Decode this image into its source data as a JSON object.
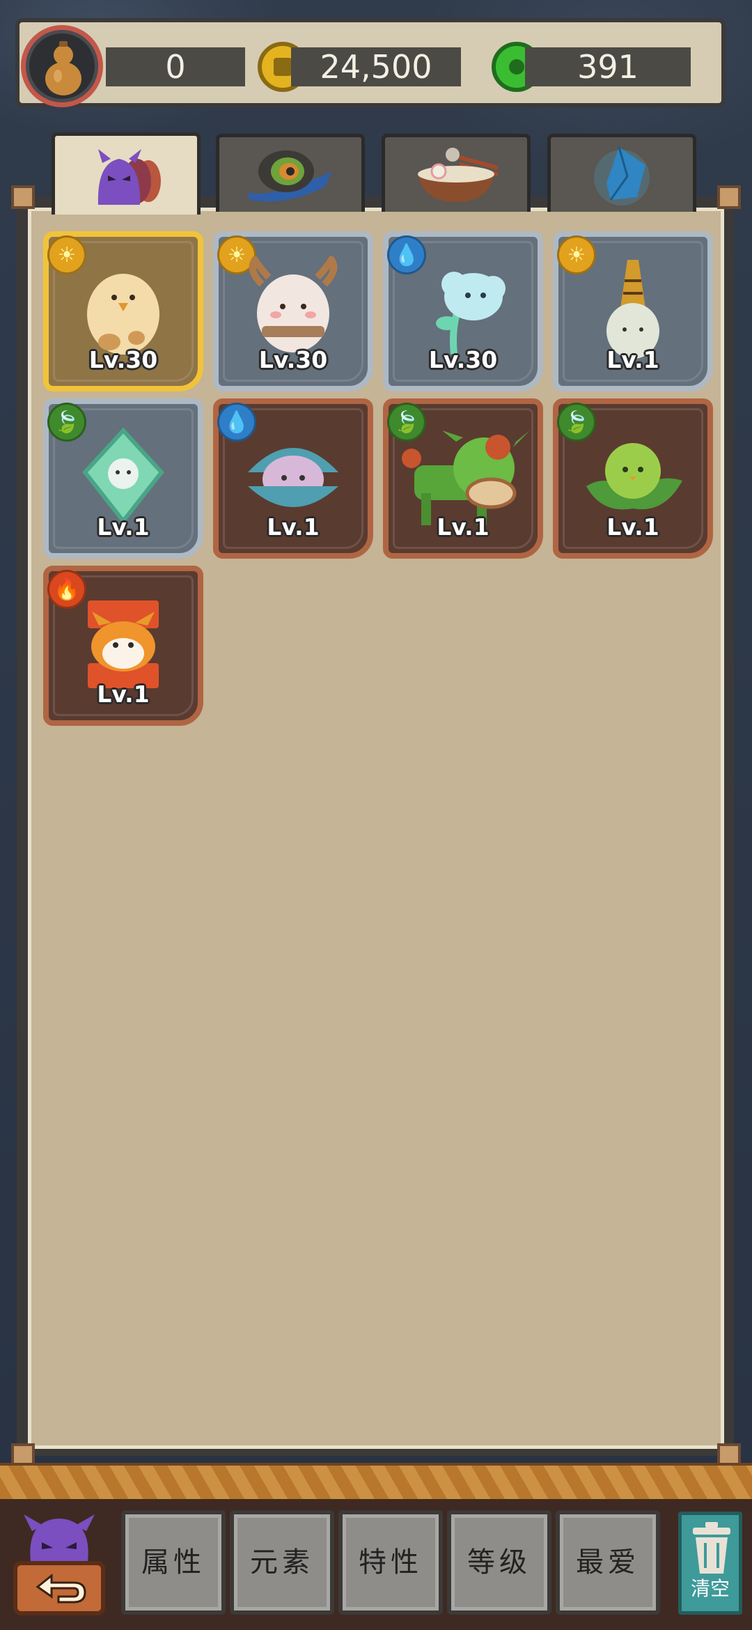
{
  "resources": {
    "gourd_count": "0",
    "coins": "24,500",
    "jade": "391"
  },
  "tabs": [
    {
      "icon": "monster-group-icon",
      "active": true
    },
    {
      "icon": "peacock-feather-icon",
      "active": false
    },
    {
      "icon": "noodle-bowl-icon",
      "active": false
    },
    {
      "icon": "blue-crystal-icon",
      "active": false
    }
  ],
  "pets": [
    {
      "level": "Lv.30",
      "rarity": "gold",
      "element": "sun",
      "creature": "chick-egg"
    },
    {
      "level": "Lv.30",
      "rarity": "silver",
      "element": "sun",
      "creature": "deer-egg"
    },
    {
      "level": "Lv.30",
      "rarity": "silver",
      "element": "water",
      "creature": "cloud-sprout"
    },
    {
      "level": "Lv.1",
      "rarity": "silver",
      "element": "sun",
      "creature": "bell-ghost"
    },
    {
      "level": "Lv.1",
      "rarity": "silver",
      "element": "leaf",
      "creature": "diamond-spirit"
    },
    {
      "level": "Lv.1",
      "rarity": "copper",
      "element": "water",
      "creature": "clam-spirit"
    },
    {
      "level": "Lv.1",
      "rarity": "copper",
      "element": "leaf",
      "creature": "bamboo-cow"
    },
    {
      "level": "Lv.1",
      "rarity": "copper",
      "element": "leaf",
      "creature": "pea-sprout"
    },
    {
      "level": "Lv.1",
      "rarity": "copper",
      "element": "fire",
      "creature": "fire-fox-box"
    }
  ],
  "sort_buttons": [
    "属性",
    "元素",
    "特性",
    "等级",
    "最爱"
  ],
  "clear_label": "清空",
  "colors": {
    "gold": "#f1c33b",
    "silver": "#aeb9c4",
    "copper": "#b06543",
    "panel": "#c5b496"
  }
}
